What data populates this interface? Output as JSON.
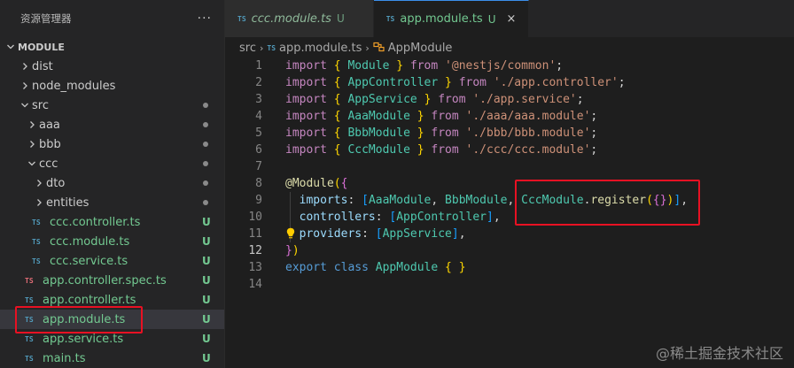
{
  "explorer": {
    "title": "资源管理器",
    "more_icon": "ellipsis-icon",
    "section_title": "MODULE",
    "items": [
      {
        "label": "dist",
        "kind": "folder",
        "expanded": false,
        "depth": 0,
        "status": ""
      },
      {
        "label": "node_modules",
        "kind": "folder",
        "expanded": false,
        "depth": 0,
        "status": ""
      },
      {
        "label": "src",
        "kind": "folder",
        "expanded": true,
        "depth": 0,
        "status": "dot"
      },
      {
        "label": "aaa",
        "kind": "folder",
        "expanded": false,
        "depth": 1,
        "status": "dot"
      },
      {
        "label": "bbb",
        "kind": "folder",
        "expanded": false,
        "depth": 1,
        "status": "dot"
      },
      {
        "label": "ccc",
        "kind": "folder",
        "expanded": true,
        "depth": 1,
        "status": "dot"
      },
      {
        "label": "dto",
        "kind": "folder",
        "expanded": false,
        "depth": 2,
        "status": "dot"
      },
      {
        "label": "entities",
        "kind": "folder",
        "expanded": false,
        "depth": 2,
        "status": "dot"
      },
      {
        "label": "ccc.controller.ts",
        "kind": "ts",
        "depth": 2,
        "status": "U"
      },
      {
        "label": "ccc.module.ts",
        "kind": "ts",
        "depth": 2,
        "status": "U"
      },
      {
        "label": "ccc.service.ts",
        "kind": "ts",
        "depth": 2,
        "status": "U"
      },
      {
        "label": "app.controller.spec.ts",
        "kind": "ts-spec",
        "depth": 1,
        "status": "U"
      },
      {
        "label": "app.controller.ts",
        "kind": "ts",
        "depth": 1,
        "status": "U"
      },
      {
        "label": "app.module.ts",
        "kind": "ts",
        "depth": 1,
        "status": "U",
        "selected": true
      },
      {
        "label": "app.service.ts",
        "kind": "ts",
        "depth": 1,
        "status": "U"
      },
      {
        "label": "main.ts",
        "kind": "ts",
        "depth": 1,
        "status": "U"
      }
    ]
  },
  "tabs": [
    {
      "icon_text": "TS",
      "label": "ccc.module.ts",
      "badge": "U",
      "active": false
    },
    {
      "icon_text": "TS",
      "label": "app.module.ts",
      "badge": "U",
      "active": true,
      "close": "×"
    }
  ],
  "breadcrumb": {
    "folder": "src",
    "file_icon": "TS",
    "file": "app.module.ts",
    "symbol": "AppModule",
    "symbol_icon": "class-icon"
  },
  "code": {
    "current_line": 12,
    "lines": [
      {
        "n": "1",
        "tokens": [
          [
            "kw",
            "import"
          ],
          [
            "punc",
            " "
          ],
          [
            "br1",
            "{"
          ],
          [
            "punc",
            " "
          ],
          [
            "cls",
            "Module"
          ],
          [
            "punc",
            " "
          ],
          [
            "br1",
            "}"
          ],
          [
            "punc",
            " "
          ],
          [
            "kw",
            "from"
          ],
          [
            "punc",
            " "
          ],
          [
            "str",
            "'@nestjs/common'"
          ],
          [
            "punc",
            ";"
          ]
        ]
      },
      {
        "n": "2",
        "tokens": [
          [
            "kw",
            "import"
          ],
          [
            "punc",
            " "
          ],
          [
            "br1",
            "{"
          ],
          [
            "punc",
            " "
          ],
          [
            "cls",
            "AppController"
          ],
          [
            "punc",
            " "
          ],
          [
            "br1",
            "}"
          ],
          [
            "punc",
            " "
          ],
          [
            "kw",
            "from"
          ],
          [
            "punc",
            " "
          ],
          [
            "str",
            "'./app.controller'"
          ],
          [
            "punc",
            ";"
          ]
        ]
      },
      {
        "n": "3",
        "tokens": [
          [
            "kw",
            "import"
          ],
          [
            "punc",
            " "
          ],
          [
            "br1",
            "{"
          ],
          [
            "punc",
            " "
          ],
          [
            "cls",
            "AppService"
          ],
          [
            "punc",
            " "
          ],
          [
            "br1",
            "}"
          ],
          [
            "punc",
            " "
          ],
          [
            "kw",
            "from"
          ],
          [
            "punc",
            " "
          ],
          [
            "str",
            "'./app.service'"
          ],
          [
            "punc",
            ";"
          ]
        ]
      },
      {
        "n": "4",
        "tokens": [
          [
            "kw",
            "import"
          ],
          [
            "punc",
            " "
          ],
          [
            "br1",
            "{"
          ],
          [
            "punc",
            " "
          ],
          [
            "cls",
            "AaaModule"
          ],
          [
            "punc",
            " "
          ],
          [
            "br1",
            "}"
          ],
          [
            "punc",
            " "
          ],
          [
            "kw",
            "from"
          ],
          [
            "punc",
            " "
          ],
          [
            "str",
            "'./aaa/aaa.module'"
          ],
          [
            "punc",
            ";"
          ]
        ]
      },
      {
        "n": "5",
        "tokens": [
          [
            "kw",
            "import"
          ],
          [
            "punc",
            " "
          ],
          [
            "br1",
            "{"
          ],
          [
            "punc",
            " "
          ],
          [
            "cls",
            "BbbModule"
          ],
          [
            "punc",
            " "
          ],
          [
            "br1",
            "}"
          ],
          [
            "punc",
            " "
          ],
          [
            "kw",
            "from"
          ],
          [
            "punc",
            " "
          ],
          [
            "str",
            "'./bbb/bbb.module'"
          ],
          [
            "punc",
            ";"
          ]
        ]
      },
      {
        "n": "6",
        "tokens": [
          [
            "kw",
            "import"
          ],
          [
            "punc",
            " "
          ],
          [
            "br1",
            "{"
          ],
          [
            "punc",
            " "
          ],
          [
            "cls",
            "CccModule"
          ],
          [
            "punc",
            " "
          ],
          [
            "br1",
            "}"
          ],
          [
            "punc",
            " "
          ],
          [
            "kw",
            "from"
          ],
          [
            "punc",
            " "
          ],
          [
            "str",
            "'./ccc/ccc.module'"
          ],
          [
            "punc",
            ";"
          ]
        ]
      },
      {
        "n": "7",
        "tokens": []
      },
      {
        "n": "8",
        "tokens": [
          [
            "fn",
            "@Module"
          ],
          [
            "br1",
            "("
          ],
          [
            "br2",
            "{"
          ]
        ]
      },
      {
        "n": "9",
        "tokens": [
          [
            "punc",
            "  "
          ],
          [
            "prop",
            "imports"
          ],
          [
            "punc",
            ": "
          ],
          [
            "br3",
            "["
          ],
          [
            "cls",
            "AaaModule"
          ],
          [
            "punc",
            ", "
          ],
          [
            "cls",
            "BbbModule"
          ],
          [
            "punc",
            ", "
          ],
          [
            "cls",
            "CccModule"
          ],
          [
            "punc",
            "."
          ],
          [
            "fn",
            "register"
          ],
          [
            "br1",
            "("
          ],
          [
            "br2",
            "{}"
          ],
          [
            "br1",
            ")"
          ],
          [
            "br3",
            "]"
          ],
          [
            "punc",
            ","
          ]
        ]
      },
      {
        "n": "10",
        "tokens": [
          [
            "punc",
            "  "
          ],
          [
            "prop",
            "controllers"
          ],
          [
            "punc",
            ": "
          ],
          [
            "br3",
            "["
          ],
          [
            "cls",
            "AppController"
          ],
          [
            "br3",
            "]"
          ],
          [
            "punc",
            ","
          ]
        ]
      },
      {
        "n": "11",
        "tokens": [
          [
            "punc",
            "  "
          ],
          [
            "prop",
            "providers"
          ],
          [
            "punc",
            ": "
          ],
          [
            "br3",
            "["
          ],
          [
            "cls",
            "AppService"
          ],
          [
            "br3",
            "]"
          ],
          [
            "punc",
            ","
          ]
        ]
      },
      {
        "n": "12",
        "tokens": [
          [
            "br2",
            "}"
          ],
          [
            "br1",
            ")"
          ]
        ]
      },
      {
        "n": "13",
        "tokens": [
          [
            "kw2",
            "export"
          ],
          [
            "punc",
            " "
          ],
          [
            "kw2",
            "class"
          ],
          [
            "punc",
            " "
          ],
          [
            "cls",
            "AppModule"
          ],
          [
            "punc",
            " "
          ],
          [
            "br1",
            "{"
          ],
          [
            "punc",
            " "
          ],
          [
            "br1",
            "}"
          ]
        ]
      },
      {
        "n": "14",
        "tokens": []
      }
    ]
  },
  "watermark": "@稀土掘金技术社区",
  "colors": {
    "annotation": "#e81123",
    "modified_green": "#73c991",
    "ts_blue": "#519aba",
    "ts_spec_red": "#e06c75"
  }
}
